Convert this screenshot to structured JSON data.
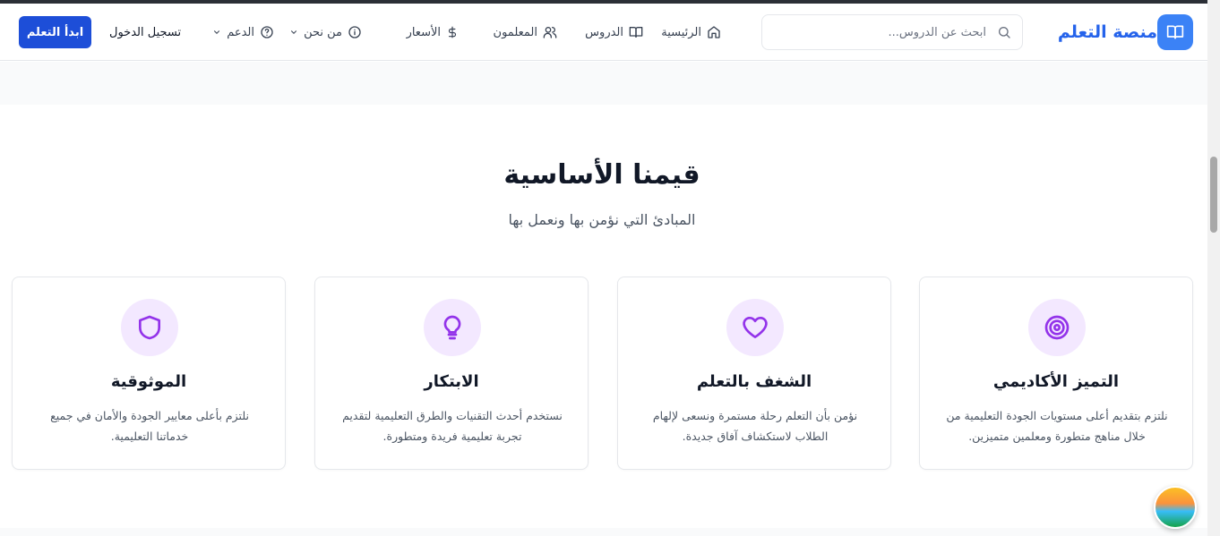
{
  "header": {
    "logo_text": "منصة التعلم",
    "search_placeholder": "ابحث عن الدروس...",
    "nav": {
      "home": "الرئيسية",
      "lessons": "الدروس",
      "teachers": "المعلمون",
      "pricing": "الأسعار",
      "about": "من نحن",
      "support": "الدعم"
    },
    "login": "تسجيل الدخول",
    "cta": "ابدأ التعلم"
  },
  "section": {
    "title": "قيمنا الأساسية",
    "subtitle": "المبادئ التي نؤمن بها ونعمل بها"
  },
  "cards": [
    {
      "icon": "target-icon",
      "title": "التميز الأكاديمي",
      "desc": "نلتزم بتقديم أعلى مستويات الجودة التعليمية من خلال مناهج متطورة ومعلمين متميزين."
    },
    {
      "icon": "heart-icon",
      "title": "الشغف بالتعلم",
      "desc": "نؤمن بأن التعلم رحلة مستمرة ونسعى لإلهام الطلاب لاستكشاف آفاق جديدة."
    },
    {
      "icon": "lightbulb-icon",
      "title": "الابتكار",
      "desc": "نستخدم أحدث التقنيات والطرق التعليمية لتقديم تجربة تعليمية فريدة ومتطورة."
    },
    {
      "icon": "shield-icon",
      "title": "الموثوقية",
      "desc": "نلتزم بأعلى معايير الجودة والأمان في جميع خدماتنا التعليمية."
    }
  ],
  "colors": {
    "brand": "#2563eb",
    "cta": "#1d4ed8",
    "icon_accent": "#9333ea",
    "icon_bg": "#f3e8ff"
  }
}
